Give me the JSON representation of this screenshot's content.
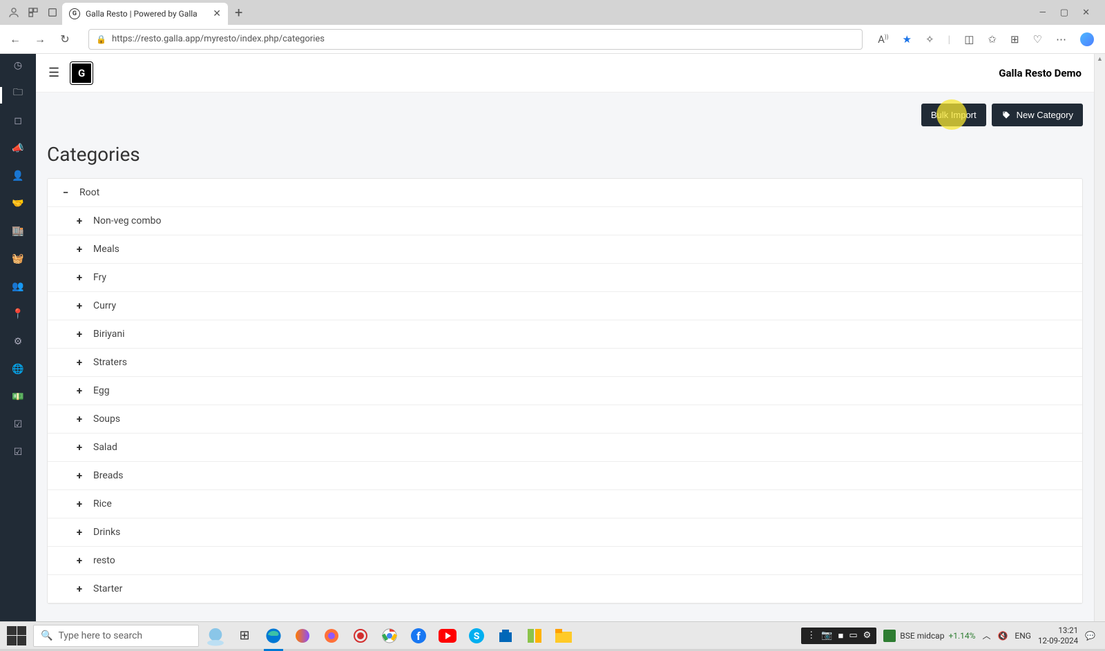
{
  "browser": {
    "tab_title": "Galla Resto | Powered by Galla",
    "url": "https://resto.galla.app/myresto/index.php/categories"
  },
  "header": {
    "user_label": "Galla Resto Demo"
  },
  "actions": {
    "bulk_import": "Bulk Import",
    "new_category": "New Category"
  },
  "page": {
    "title": "Categories"
  },
  "tree": {
    "root": "Root",
    "children": [
      "Non-veg combo",
      "Meals",
      "Fry",
      "Curry",
      "Biriyani",
      "Straters",
      "Egg",
      "Soups",
      "Salad",
      "Breads",
      "Rice",
      "Drinks",
      "resto",
      "Starter"
    ]
  },
  "taskbar": {
    "search_placeholder": "Type here to search",
    "stock_label": "BSE midcap",
    "stock_pct": "+1.14%",
    "lang": "ENG",
    "time": "13:21",
    "date": "12-09-2024"
  }
}
